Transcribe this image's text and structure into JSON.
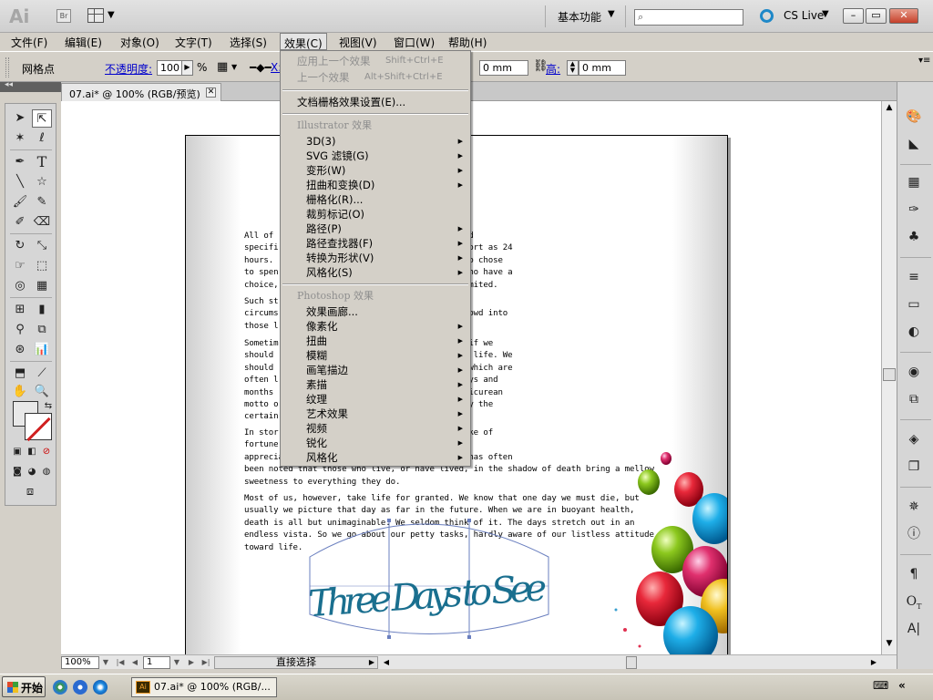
{
  "app": {
    "logo": "Ai",
    "bridge_label": "Br",
    "workspace": "基本功能",
    "cs_live": "CS Live",
    "win_min": "–",
    "win_max": "▭",
    "win_close": "✕"
  },
  "menubar": [
    {
      "label": "文件(F)"
    },
    {
      "label": "编辑(E)"
    },
    {
      "label": "对象(O)"
    },
    {
      "label": "文字(T)"
    },
    {
      "label": "选择(S)"
    },
    {
      "label": "效果(C)"
    },
    {
      "label": "视图(V)"
    },
    {
      "label": "窗口(W)"
    },
    {
      "label": "帮助(H)"
    }
  ],
  "controlbar": {
    "mode_label": "网格点",
    "opacity_label": "不透明度:",
    "opacity_value": "100",
    "opacity_unit": "%",
    "x_label": "X:",
    "w_value": "0 mm",
    "h_label": "高:",
    "h_value": "0 mm"
  },
  "document": {
    "tab_title": "07.ai* @ 100% (RGB/预览)",
    "tab_close": "✕",
    "paragraphs": [
      "All of          the hero had only a limited and\nspecifi         ong as a year, sometimes as short as 24\nhours.          vering just how the doomed hero chose\nto spen         peak, of course, of free men who have a\nchoice,         of activities is strictly delimited.",
      "Such st         we should do under similar\ncircums         what associations should we crowd into\nthose l         ts?",
      "Sometim         lent rule to live each day as if we\nshould          mphasize sharply the values of life. We\nshould          nd a keenness of appreciation which are\noften l         e constant panorama of more days and\nmonths          course, who would adopt the Epicurean\nmotto o         st people would be chastened by the\ncertain",
      "In stor         t the last minute by some stroke of\nfortune         is changed. He becomes more\napprecia        ermanent spiritual values. It has often\nbeen noted that those who live, or have lived, in the shadow of death bring a mellow\nsweetness to everything they do.",
      "Most of us, however, take life for granted. We know that one day we must die, but\nusually we picture that day as far in the future. When we are in buoyant health,\ndeath is all but unimaginable. We seldom think of it. The days stretch out in an\nendless vista. So we go about our petty tasks, hardly aware of our listless attitude\ntoward life."
    ],
    "title_art": "Three Days to See"
  },
  "statusbar": {
    "zoom": "100%",
    "page": "1",
    "tool_status": "直接选择"
  },
  "effects_menu": {
    "apply_last": "应用上一个效果",
    "apply_last_sc": "Shift+Ctrl+E",
    "last_effect": "上一个效果",
    "last_effect_sc": "Alt+Shift+Ctrl+E",
    "raster_settings": "文档栅格效果设置(E)...",
    "illustrator_header": "Illustrator 效果",
    "illustrator_items": [
      {
        "label": "3D(3)",
        "sub": "▶"
      },
      {
        "label": "SVG 滤镜(G)",
        "sub": "▶"
      },
      {
        "label": "变形(W)",
        "sub": "▶"
      },
      {
        "label": "扭曲和变换(D)",
        "sub": "▶"
      },
      {
        "label": "栅格化(R)...",
        "sub": ""
      },
      {
        "label": "裁剪标记(O)",
        "sub": ""
      },
      {
        "label": "路径(P)",
        "sub": "▶"
      },
      {
        "label": "路径查找器(F)",
        "sub": "▶"
      },
      {
        "label": "转换为形状(V)",
        "sub": "▶"
      },
      {
        "label": "风格化(S)",
        "sub": "▶"
      }
    ],
    "photoshop_header": "Photoshop 效果",
    "photoshop_items": [
      {
        "label": "效果画廊...",
        "sub": ""
      },
      {
        "label": "像素化",
        "sub": "▶"
      },
      {
        "label": "扭曲",
        "sub": "▶"
      },
      {
        "label": "模糊",
        "sub": "▶"
      },
      {
        "label": "画笔描边",
        "sub": "▶"
      },
      {
        "label": "素描",
        "sub": "▶"
      },
      {
        "label": "纹理",
        "sub": "▶"
      },
      {
        "label": "艺术效果",
        "sub": "▶"
      },
      {
        "label": "视频",
        "sub": "▶"
      },
      {
        "label": "锐化",
        "sub": "▶"
      },
      {
        "label": "风格化",
        "sub": "▶"
      }
    ]
  },
  "taskbar": {
    "start": "开始",
    "task": "07.ai* @ 100% (RGB/...",
    "tray": "«"
  },
  "colors": {
    "chrome": "#d4d0c8",
    "accent_blue": "#1e88c8",
    "title_art": "#1a6f8f"
  }
}
